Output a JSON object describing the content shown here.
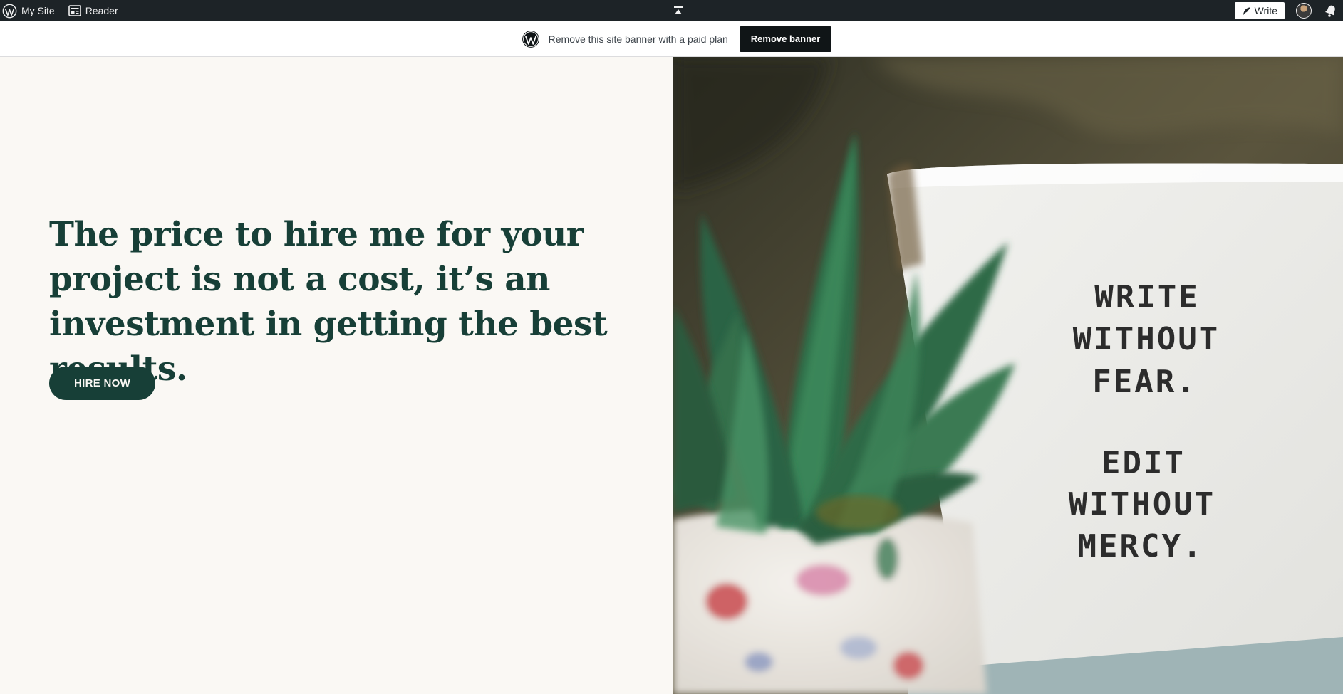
{
  "adminbar": {
    "my_site_label": "My Site",
    "reader_label": "Reader",
    "write_label": "Write"
  },
  "banner": {
    "text": "Remove this site banner with a paid plan",
    "button_label": "Remove banner"
  },
  "hero": {
    "headline": "The price to hire me for your project is not a cost, it’s an investment in getting the best results.",
    "button_label": "HIRE NOW"
  },
  "image": {
    "sign_lines": [
      "WRITE",
      "WITHOUT",
      "FEAR.",
      "EDIT",
      "WITHOUT",
      "MERCY."
    ]
  },
  "colors": {
    "admin_bar": "#1d2327",
    "brand_green": "#173f37",
    "page_bg": "#faf8f4",
    "banner_button": "#101517"
  }
}
